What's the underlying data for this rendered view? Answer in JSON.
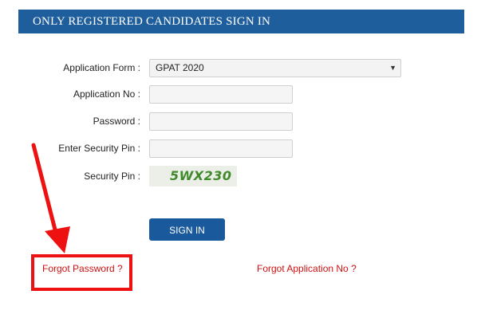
{
  "header": {
    "title": "ONLY REGISTERED CANDIDATES SIGN IN"
  },
  "form": {
    "application_form_label": "Application Form :",
    "application_form_value": "GPAT 2020",
    "application_no_label": "Application No :",
    "application_no_value": "",
    "password_label": "Password :",
    "password_value": "",
    "security_pin_input_label": "Enter Security Pin :",
    "security_pin_input_value": "",
    "security_pin_label": "Security Pin :",
    "security_pin_captcha": "5WX230"
  },
  "actions": {
    "signin_label": "SIGN IN",
    "forgot_password_label": "Forgot Password ?",
    "forgot_application_label": "Forgot Application No ?"
  },
  "colors": {
    "header_bg": "#1f5e9c",
    "button_bg": "#1a5a9c",
    "link": "#d01010",
    "annotation": "#ee1111",
    "captcha_text": "#3f8a2b"
  },
  "icons": {
    "dropdown": "chevron-down-icon",
    "annotation_arrow": "arrow-icon"
  }
}
